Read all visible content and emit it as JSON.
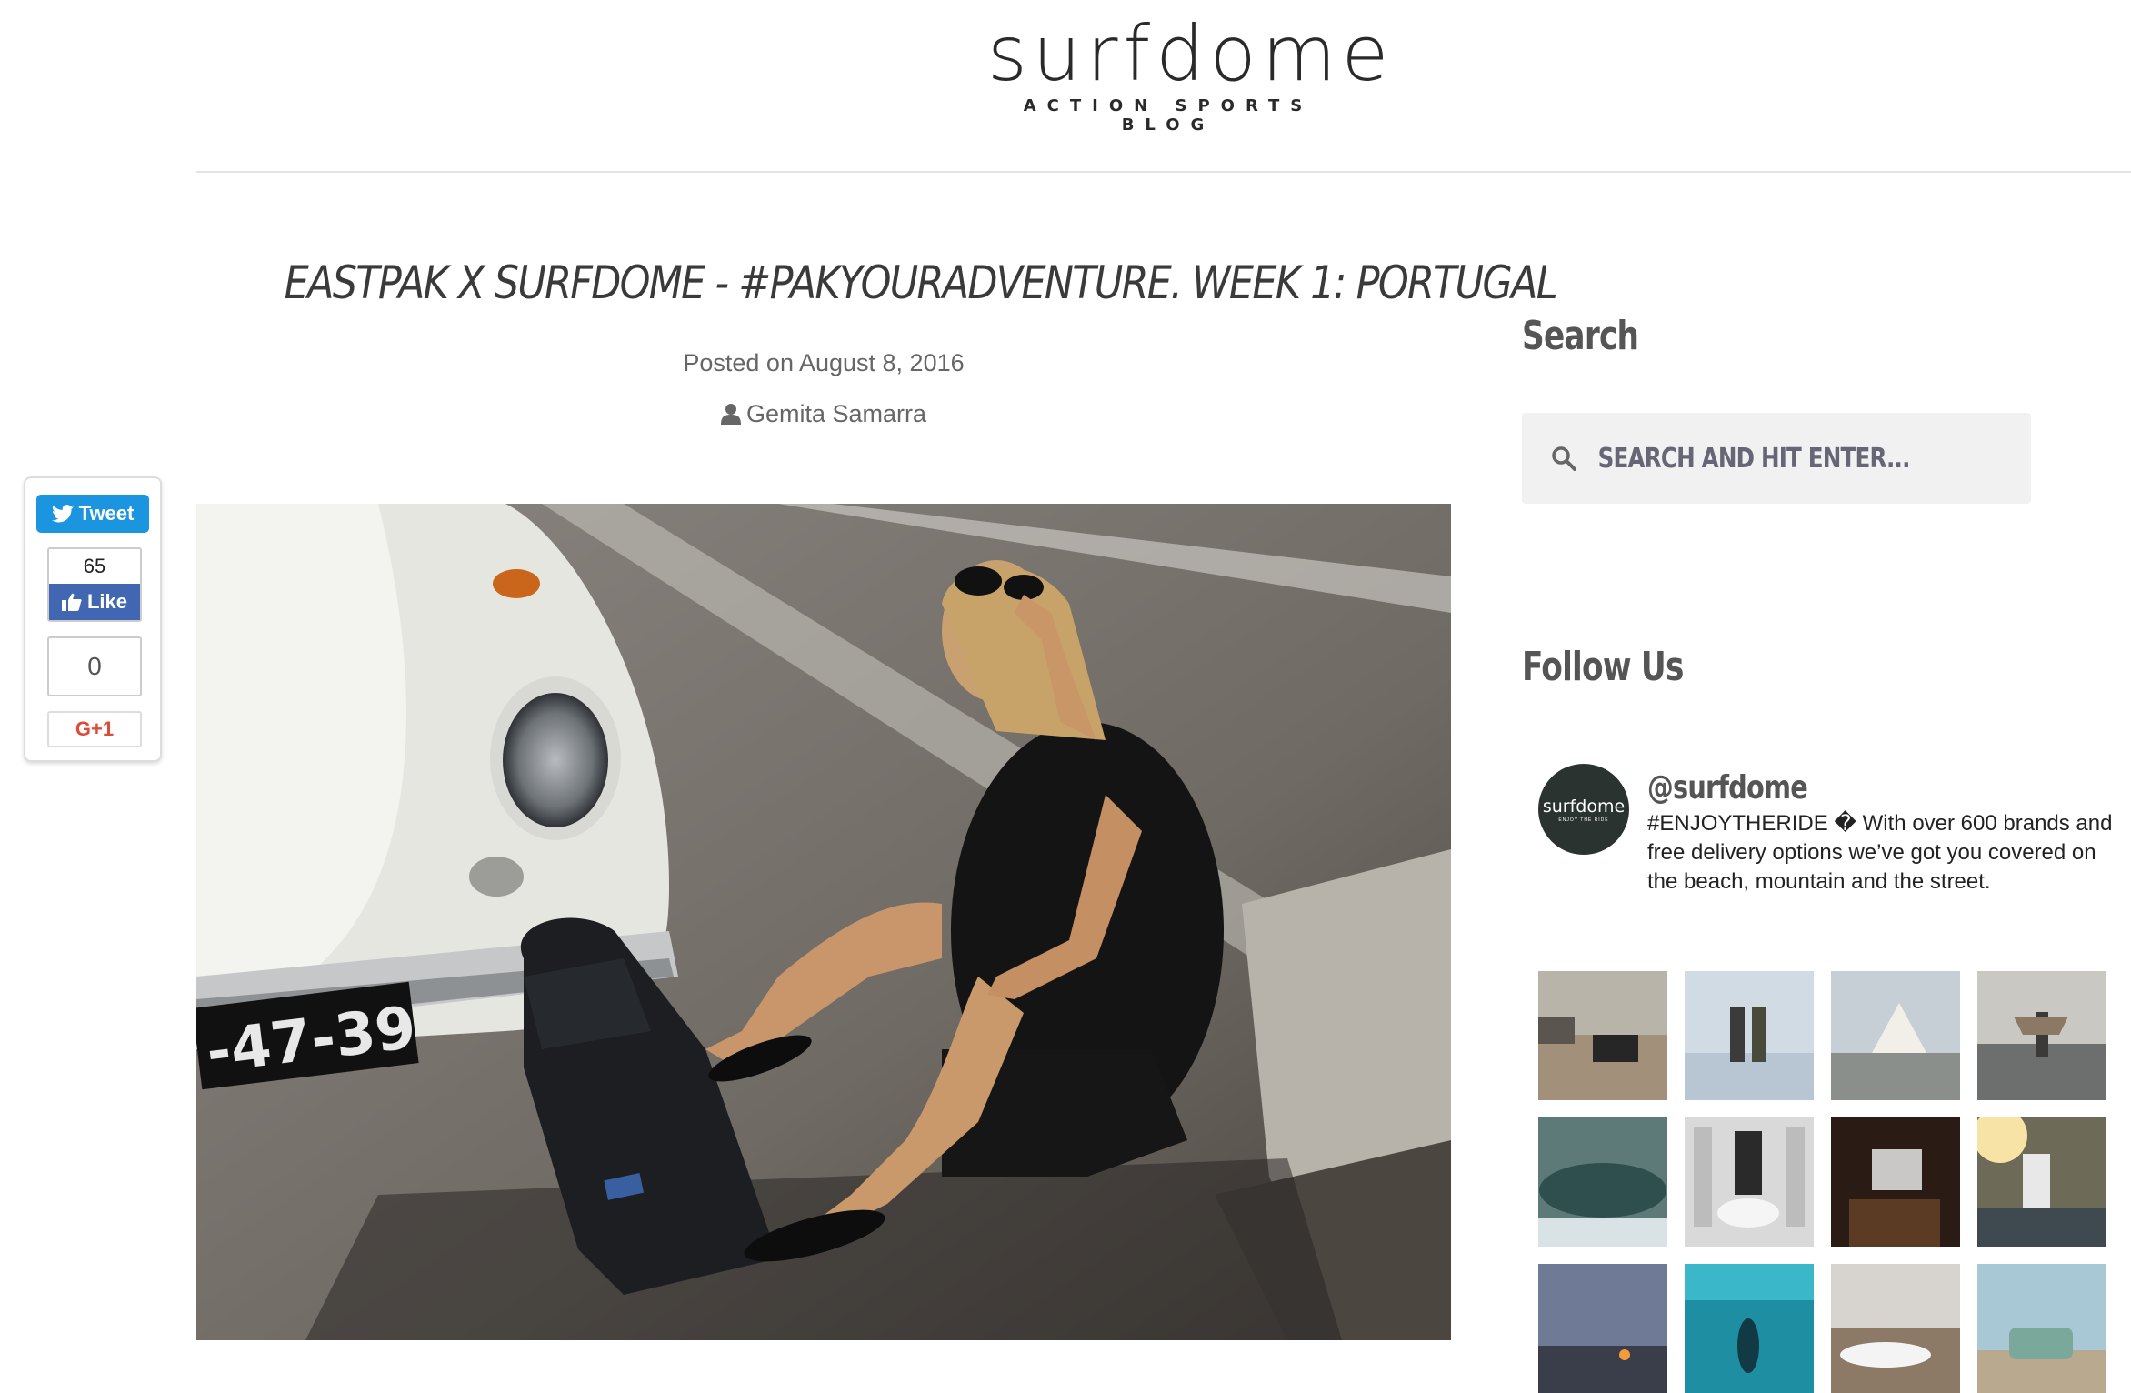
{
  "header": {
    "logo_word": "surfdome",
    "logo_tagline": "ACTION SPORTS BLOG"
  },
  "article": {
    "title": "EASTPAK X SURFDOME - #PAKYOURADVENTURE. WEEK 1: PORTUGAL",
    "posted_label": "Posted on August 8, 2016",
    "author": "Gemita Samarra",
    "hero_image_label": "-47-39"
  },
  "share": {
    "tweet_label": "Tweet",
    "like_count": "65",
    "like_label": "Like",
    "gplus_count": "0",
    "gplus_label": "G+1"
  },
  "sidebar": {
    "search_title": "Search",
    "search_placeholder": "SEARCH AND HIT ENTER...",
    "follow_title": "Follow Us",
    "instagram": {
      "avatar_word": "surfdome",
      "avatar_tagline": "ENJOY THE RIDE",
      "handle": "@surfdome",
      "bio": "#ENJOYTHERIDE � With over 600 brands and free delivery options we’ve got you covered on the beach, mountain and the street."
    }
  },
  "colors": {
    "twitter_blue": "#1b95e0",
    "facebook_blue": "#4267b2",
    "gplus_red": "#dd4b39",
    "search_bg": "#f1f1f1",
    "avatar_bg": "#2b3330"
  },
  "icons": {
    "twitter": "twitter-bird-icon",
    "facebook": "thumbs-up-icon",
    "search": "search-icon",
    "author": "user-icon"
  }
}
